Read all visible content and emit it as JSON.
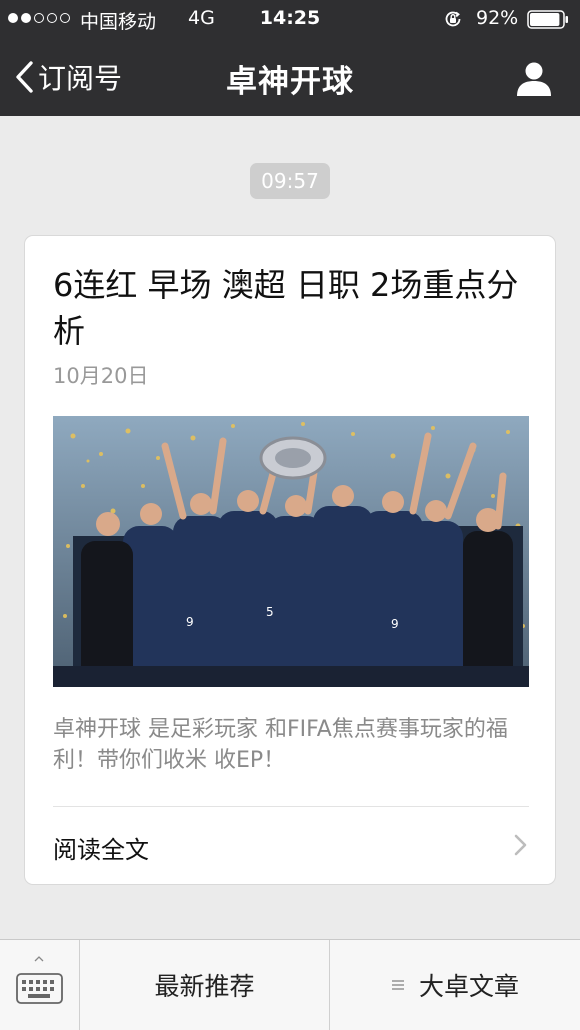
{
  "status_bar": {
    "carrier": "中国移动",
    "network": "4G",
    "time": "14:25",
    "battery_percent": "92%",
    "signal_strength": 2,
    "signal_dots": 5,
    "battery_level": 0.92
  },
  "nav": {
    "back_label": "订阅号",
    "title": "卓神开球",
    "back_icon": "chevron-left-icon",
    "profile_icon": "person-icon"
  },
  "message_time": "09:57",
  "article": {
    "title": "6连红  早场 澳超  日职  2场重点分析",
    "date": "10月20日",
    "summary": "卓神开球 是足彩玩家 和FIFA焦点赛事玩家的福利！带你们收米 收EP！",
    "read_more": "阅读全文",
    "cover_image": "soccer-team-trophy-celebration-photo"
  },
  "bottom_menu": {
    "keyboard_icon": "keyboard-icon",
    "items": [
      {
        "label": "最新推荐",
        "has_submenu": false
      },
      {
        "label": "大卓文章",
        "has_submenu": true
      }
    ]
  },
  "colors": {
    "topbar": "#2f2f31",
    "background": "#ebebeb",
    "card": "#ffffff",
    "muted_text": "#999999",
    "timestamp_pill": "#cecece"
  }
}
